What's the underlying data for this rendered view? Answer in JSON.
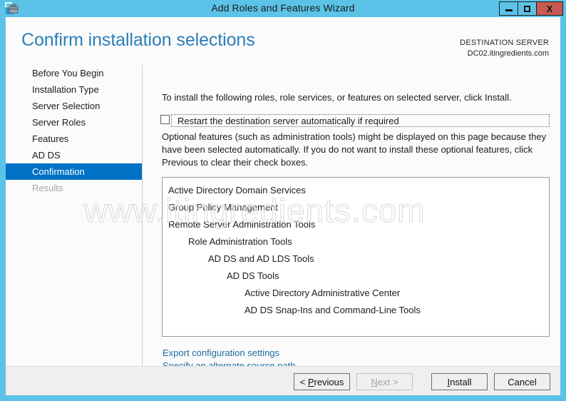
{
  "window": {
    "title": "Add Roles and Features Wizard",
    "icon": "wizard-toolbox-icon",
    "minimize_label": "–",
    "maximize_label": "□",
    "close_label": "X",
    "titlebar_color": "#5cc3e8",
    "close_button_color": "#c75b52"
  },
  "header": {
    "page_title": "Confirm installation selections",
    "destination_label": "DESTINATION SERVER",
    "destination_value": "DC02.itingredients.com",
    "accent_color": "#2a7fb8"
  },
  "sidebar": {
    "selected_color": "#0072c6",
    "items": [
      {
        "label": "Before You Begin",
        "state": "normal"
      },
      {
        "label": "Installation Type",
        "state": "normal"
      },
      {
        "label": "Server Selection",
        "state": "normal"
      },
      {
        "label": "Server Roles",
        "state": "normal"
      },
      {
        "label": "Features",
        "state": "normal"
      },
      {
        "label": "AD DS",
        "state": "normal"
      },
      {
        "label": "Confirmation",
        "state": "selected"
      },
      {
        "label": "Results",
        "state": "disabled"
      }
    ]
  },
  "main": {
    "intro_text": "To install the following roles, role services, or features on selected server, click Install.",
    "restart_checkbox_label": "Restart the destination server automatically if required",
    "restart_checkbox_checked": false,
    "optional_text": "Optional features (such as administration tools) might be displayed on this page because they have been selected automatically. If you do not want to install these optional features, click Previous to clear their check boxes.",
    "feature_list": [
      {
        "label": "Active Directory Domain Services",
        "indent": 0
      },
      {
        "label": "Group Policy Management",
        "indent": 0
      },
      {
        "label": "Remote Server Administration Tools",
        "indent": 0
      },
      {
        "label": "Role Administration Tools",
        "indent": 1
      },
      {
        "label": "AD DS and AD LDS Tools",
        "indent": 2
      },
      {
        "label": "AD DS Tools",
        "indent": 3
      },
      {
        "label": "Active Directory Administrative Center",
        "indent": 4
      },
      {
        "label": "AD DS Snap-Ins and Command-Line Tools",
        "indent": 4
      }
    ],
    "links": [
      {
        "label": "Export configuration settings"
      },
      {
        "label": "Specify an alternate source path"
      }
    ],
    "link_color": "#1c6ea4"
  },
  "footer": {
    "buttons": [
      {
        "label": "< Previous",
        "accesskey": "P",
        "state": "enabled"
      },
      {
        "label": "Next >",
        "accesskey": "N",
        "state": "disabled"
      },
      {
        "label": "Install",
        "accesskey": "I",
        "state": "enabled"
      },
      {
        "label": "Cancel",
        "accesskey": "",
        "state": "enabled"
      }
    ]
  },
  "watermark": {
    "text": "www.itingredients.com"
  }
}
